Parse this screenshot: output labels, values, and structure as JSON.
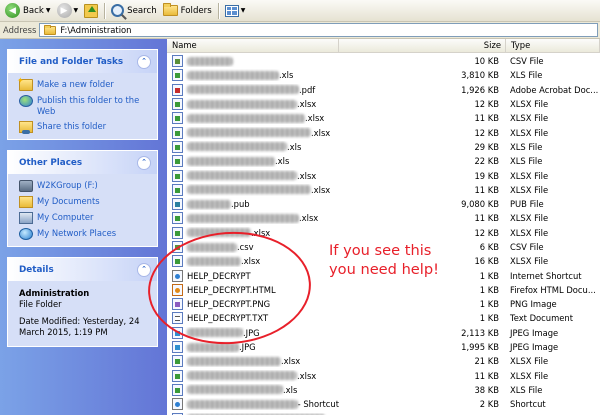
{
  "toolbar": {
    "back_label": "Back",
    "search_label": "Search",
    "folders_label": "Folders"
  },
  "address": {
    "label": "Address",
    "path": "F:\\Administration"
  },
  "tasks": {
    "title": "File and Folder Tasks",
    "items": [
      {
        "label": "Make a new folder",
        "icon": "new-folder-icon"
      },
      {
        "label": "Publish this folder to the Web",
        "icon": "globe-icon"
      },
      {
        "label": "Share this folder",
        "icon": "share-folder-icon"
      }
    ]
  },
  "places": {
    "title": "Other Places",
    "items": [
      {
        "label": "W2KGroup (F:)",
        "icon": "network-drive-icon"
      },
      {
        "label": "My Documents",
        "icon": "documents-folder-icon"
      },
      {
        "label": "My Computer",
        "icon": "computer-icon"
      },
      {
        "label": "My Network Places",
        "icon": "network-places-icon"
      }
    ]
  },
  "details": {
    "title": "Details",
    "name": "Administration",
    "kind": "File Folder",
    "modified": "Date Modified: Yesterday, 24 March 2015, 1:19 PM"
  },
  "columns": {
    "name": "Name",
    "size": "Size",
    "type": "Type"
  },
  "files": [
    {
      "suffix": "",
      "size": "10 KB",
      "type": "CSV File",
      "icon": "csv"
    },
    {
      "suffix": ".xls",
      "size": "3,810 KB",
      "type": "XLS File",
      "icon": "xls"
    },
    {
      "suffix": ".pdf",
      "size": "1,926 KB",
      "type": "Adobe Acrobat Doc...",
      "icon": "pdf"
    },
    {
      "suffix": ".xlsx",
      "size": "12 KB",
      "type": "XLSX File",
      "icon": "xls"
    },
    {
      "suffix": ".xlsx",
      "size": "11 KB",
      "type": "XLSX File",
      "icon": "xls"
    },
    {
      "suffix": ".xlsx",
      "size": "12 KB",
      "type": "XLSX File",
      "icon": "xls"
    },
    {
      "suffix": ".xls",
      "size": "29 KB",
      "type": "XLS File",
      "icon": "xls"
    },
    {
      "suffix": ".xls",
      "size": "22 KB",
      "type": "XLS File",
      "icon": "xls"
    },
    {
      "suffix": ".xlsx",
      "size": "19 KB",
      "type": "XLSX File",
      "icon": "xls"
    },
    {
      "suffix": ".xlsx",
      "size": "11 KB",
      "type": "XLSX File",
      "icon": "xls"
    },
    {
      "suffix": ".pub",
      "size": "9,080 KB",
      "type": "PUB File",
      "icon": "pub"
    },
    {
      "suffix": ".xlsx",
      "size": "11 KB",
      "type": "XLSX File",
      "icon": "xls"
    },
    {
      "suffix": ".xlsx",
      "size": "12 KB",
      "type": "XLSX File",
      "icon": "xls"
    },
    {
      "suffix": ".csv",
      "size": "6 KB",
      "type": "CSV File",
      "icon": "csv"
    },
    {
      "suffix": ".xlsx",
      "size": "16 KB",
      "type": "XLSX File",
      "icon": "xls"
    },
    {
      "name": "HELP_DECRYPT",
      "size": "1 KB",
      "type": "Internet Shortcut",
      "icon": "url"
    },
    {
      "name": "HELP_DECRYPT.HTML",
      "size": "1 KB",
      "type": "Firefox HTML Docu...",
      "icon": "html"
    },
    {
      "name": "HELP_DECRYPT.PNG",
      "size": "1 KB",
      "type": "PNG Image",
      "icon": "png"
    },
    {
      "name": "HELP_DECRYPT.TXT",
      "size": "1 KB",
      "type": "Text Document",
      "icon": "txt"
    },
    {
      "suffix": ".JPG",
      "size": "2,113 KB",
      "type": "JPEG Image",
      "icon": "jpg"
    },
    {
      "suffix": ".JPG",
      "size": "1,995 KB",
      "type": "JPEG Image",
      "icon": "jpg"
    },
    {
      "suffix": ".xlsx",
      "size": "21 KB",
      "type": "XLSX File",
      "icon": "xls"
    },
    {
      "suffix": ".xlsx",
      "size": "11 KB",
      "type": "XLSX File",
      "icon": "xls"
    },
    {
      "suffix": ".xls",
      "size": "38 KB",
      "type": "XLS File",
      "icon": "xls"
    },
    {
      "suffix": " - Shortcut",
      "size": "2 KB",
      "type": "Shortcut",
      "icon": "url"
    },
    {
      "suffix": ".xls",
      "size": "222 KB",
      "type": "XLS File",
      "icon": "xls"
    }
  ],
  "annotation": {
    "line1": "If you see this",
    "line2": "you need help!",
    "color": "#e8202a"
  }
}
